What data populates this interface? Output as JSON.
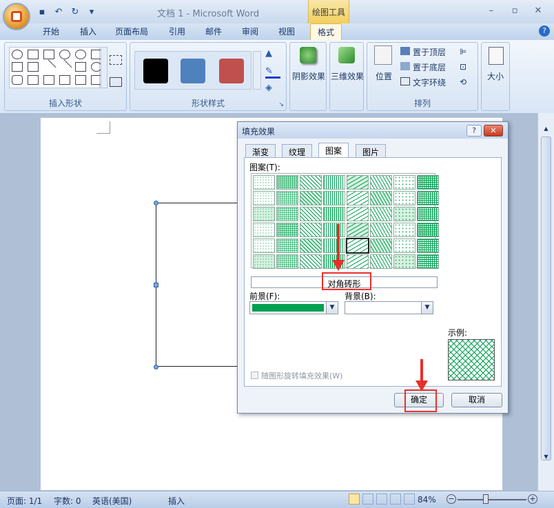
{
  "window": {
    "title": "文档 1 - Microsoft Word",
    "context_tab_group": "绘图工具"
  },
  "tabs": [
    {
      "label": "开始"
    },
    {
      "label": "插入"
    },
    {
      "label": "页面布局"
    },
    {
      "label": "引用"
    },
    {
      "label": "邮件"
    },
    {
      "label": "审阅"
    },
    {
      "label": "视图"
    },
    {
      "label": "格式",
      "active": true
    }
  ],
  "ribbon": {
    "groups": {
      "insert_shapes": "插入形状",
      "shape_styles": "形状样式",
      "arrange": "排列"
    },
    "buttons": {
      "shadow_effects": "阴影效果",
      "threed_effects": "三维效果",
      "position": "位置",
      "bring_to_front": "置于顶层",
      "send_to_back": "置于底层",
      "text_wrapping": "文字环绕",
      "size": "大小"
    },
    "style_swatches": [
      "#000000",
      "#4f81bd",
      "#c0504d"
    ]
  },
  "dialog": {
    "title": "填充效果",
    "help": "?",
    "close": "✕",
    "tabs": [
      {
        "label": "渐变"
      },
      {
        "label": "纹理"
      },
      {
        "label": "图案",
        "active": true
      },
      {
        "label": "图片"
      }
    ],
    "pattern_label": "图案(T):",
    "pattern_name": "对角砖形",
    "foreground_label": "前景(F):",
    "background_label": "背景(B):",
    "foreground_color": "#00a050",
    "background_color": "#ffffff",
    "sample_label": "示例:",
    "rotate_with_shape": "随图形旋转填充效果(W)",
    "ok": "确定",
    "cancel": "取消"
  },
  "status": {
    "page": "页面: 1/1",
    "words": "字数: 0",
    "language": "英语(美国)",
    "mode": "插入",
    "zoom": "84%"
  },
  "colors": {
    "accent_green": "#00a050",
    "highlight_red": "#e8302a"
  }
}
